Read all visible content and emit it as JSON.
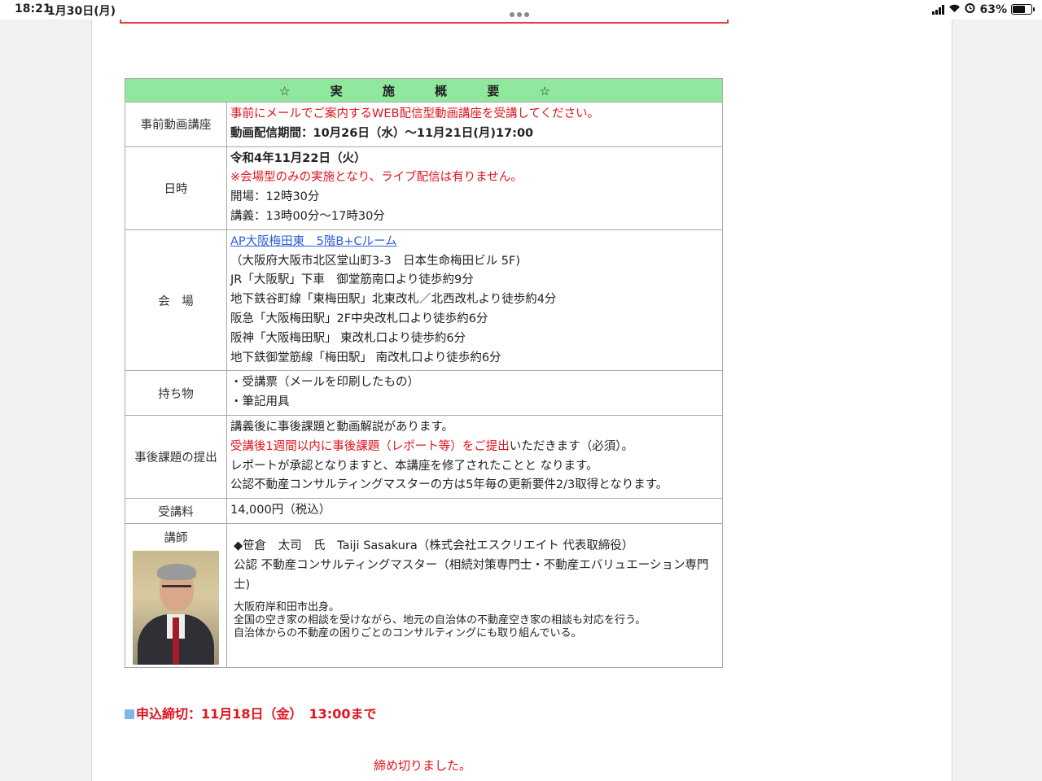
{
  "status_bar": {
    "time": "18:21",
    "date": "1月30日(月)",
    "battery": "63%",
    "battery_level": 0.63
  },
  "table": {
    "header": "☆ 実 施 概 要 ☆",
    "rows": [
      {
        "label": "事前動画講座",
        "lines": [
          {
            "text": "事前にメールでご案内するWEB配信型動画講座を受講してください。",
            "style": "red"
          },
          {
            "text": "動画配信期間：10月26日（水）〜11月21日(月)17:00",
            "style": "bold"
          }
        ]
      },
      {
        "label": "日時",
        "lines": [
          {
            "text": "令和4年11月22日（火）",
            "style": "bold"
          },
          {
            "text": "※会場型のみの実施となり、ライブ配信は有りません。",
            "style": "red"
          },
          {
            "text": "開場：12時30分",
            "style": ""
          },
          {
            "text": "講義：13時00分〜17時30分",
            "style": ""
          }
        ]
      },
      {
        "label": "会　場",
        "lines": [
          {
            "text": "AP大阪梅田東　5階B+Cルーム",
            "style": "link"
          },
          {
            "text": "（大阪府大阪市北区堂山町3-3　日本生命梅田ビル 5F)",
            "style": ""
          },
          {
            "text": "JR「大阪駅」下車　御堂筋南口より徒歩約9分",
            "style": ""
          },
          {
            "text": "地下鉄谷町線「東梅田駅」北東改札／北西改札より徒歩約4分",
            "style": ""
          },
          {
            "text": "阪急「大阪梅田駅」2F中央改札口より徒歩約6分",
            "style": ""
          },
          {
            "text": "阪神「大阪梅田駅」 東改札口より徒歩約6分",
            "style": ""
          },
          {
            "text": "地下鉄御堂筋線「梅田駅」 南改札口より徒歩約6分",
            "style": ""
          }
        ]
      },
      {
        "label": "持ち物",
        "lines": [
          {
            "text": "・受講票（メールを印刷したもの）",
            "style": ""
          },
          {
            "text": "・筆記用具",
            "style": ""
          }
        ]
      },
      {
        "label": "事後課題の提出",
        "lines": [
          {
            "text": "講義後に事後課題と動画解説があります。",
            "style": ""
          },
          {
            "text": "",
            "style": "mixed"
          },
          {
            "text": "レポートが承認となりますと、本講座を修了されたことと なります。",
            "style": ""
          },
          {
            "text": "公認不動産コンサルティングマスターの方は5年毎の更新要件2/3取得となります。",
            "style": ""
          }
        ]
      },
      {
        "label": "受講料",
        "lines": [
          {
            "text": "14,000円（税込）",
            "style": ""
          }
        ]
      }
    ],
    "report_red": "受講後1週間以内に事後課題（レポート等）をご提出",
    "report_black": "いただきます（必須）。",
    "instructor": {
      "label": "講師",
      "name_line": "◆笹倉　太司　氏　Taiji Sasakura（株式会社エスクリエイト 代表取締役）",
      "cred_line": "公認 不動産コンサルティングマスター（相続対策専門士・不動産エバリュエーション専門士)",
      "bio": [
        "大阪府岸和田市出身。",
        "全国の空き家の相談を受けながら、地元の自治体の不動産空き家の相談も対応を行う。",
        "自治体からの不動産の困りごとのコンサルティングにも取り組んでいる。"
      ]
    }
  },
  "deadline": "申込締切：11月18日（金）　13:00まで",
  "closed_notice": "締め切りました。"
}
